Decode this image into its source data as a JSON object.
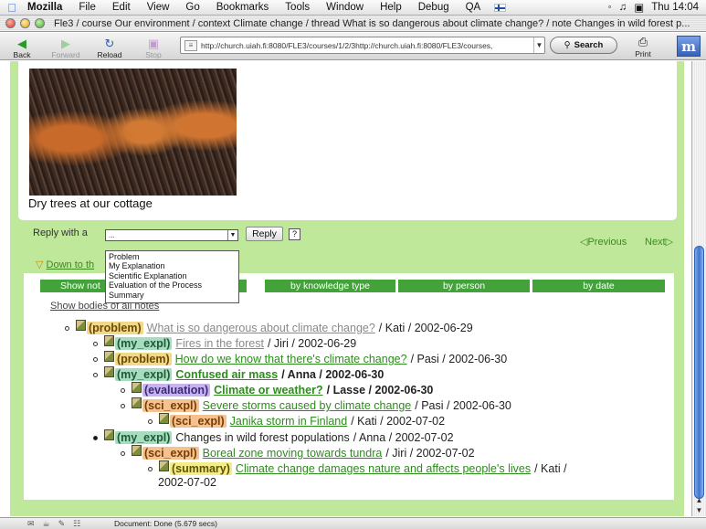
{
  "menubar": {
    "app": "Mozilla",
    "items": [
      "File",
      "Edit",
      "View",
      "Go",
      "Bookmarks",
      "Tools",
      "Window",
      "Help",
      "Debug",
      "QA"
    ],
    "clock": "Thu 14:04"
  },
  "window": {
    "title": "Fle3 / course Our environment / context Climate change / thread What is so dangerous about climate change? / note Changes in wild forest p..."
  },
  "toolbar": {
    "back": "Back",
    "forward": "Forward",
    "reload": "Reload",
    "stop": "Stop",
    "url": "http://church.uiah.fi:8080/FLE3/courses/1/2/3http://church.uiah.fi:8080/FLE3/courses,",
    "search": "Search",
    "print": "Print"
  },
  "note": {
    "caption": "Dry trees at our cottage"
  },
  "reply": {
    "label": "Reply with a",
    "select_value": "...",
    "button": "Reply",
    "help": "?",
    "options": [
      "Problem",
      "My Explanation",
      "Scientific Explanation",
      "Evaluation of the Process",
      "Summary"
    ]
  },
  "nav": {
    "previous": "Previous",
    "next": "Next",
    "down": "Down to th"
  },
  "tabs": [
    "Show not",
    "by knowledge type",
    "by person",
    "by date"
  ],
  "show_bodies": "Show bodies of all notes",
  "thread": [
    {
      "tag": "(problem)",
      "title": "What is so dangerous about climate change?",
      "meta": "/ Kati / 2002-06-29"
    },
    {
      "tag": "(my_expl)",
      "title": "Fires in the forest",
      "meta": "/ Jiri / 2002-06-29"
    },
    {
      "tag": "(problem)",
      "title": "How do we know that there's climate change?",
      "meta": "/ Pasi / 2002-06-30"
    },
    {
      "tag": "(my_expl)",
      "title": "Confused air mass",
      "meta": "/ Anna / 2002-06-30"
    },
    {
      "tag": "(evaluation)",
      "title": "Climate or weather?",
      "meta": "/ Lasse / 2002-06-30"
    },
    {
      "tag": "(sci_expl)",
      "title": "Severe storms caused by climate change",
      "meta": "/ Pasi / 2002-06-30"
    },
    {
      "tag": "(sci_expl)",
      "title": "Janika storm in Finland",
      "meta": "/ Kati / 2002-07-02"
    },
    {
      "tag": "(my_expl)",
      "title": "Changes in wild forest populations",
      "meta": "/ Anna / 2002-07-02"
    },
    {
      "tag": "(sci_expl)",
      "title": "Boreal zone moving towards tundra",
      "meta": "/ Jiri / 2002-07-02"
    },
    {
      "tag": "(summary)",
      "title": "Climate change damages nature and affects people's lives",
      "meta": "/ Kati /",
      "meta2": "2002-07-02"
    }
  ],
  "status": {
    "text": "Document: Done (5.679 secs)"
  },
  "colors": {
    "frame_green": "#bfe89a",
    "tab_green": "#43a33a",
    "link_green": "#2e8b1e"
  }
}
